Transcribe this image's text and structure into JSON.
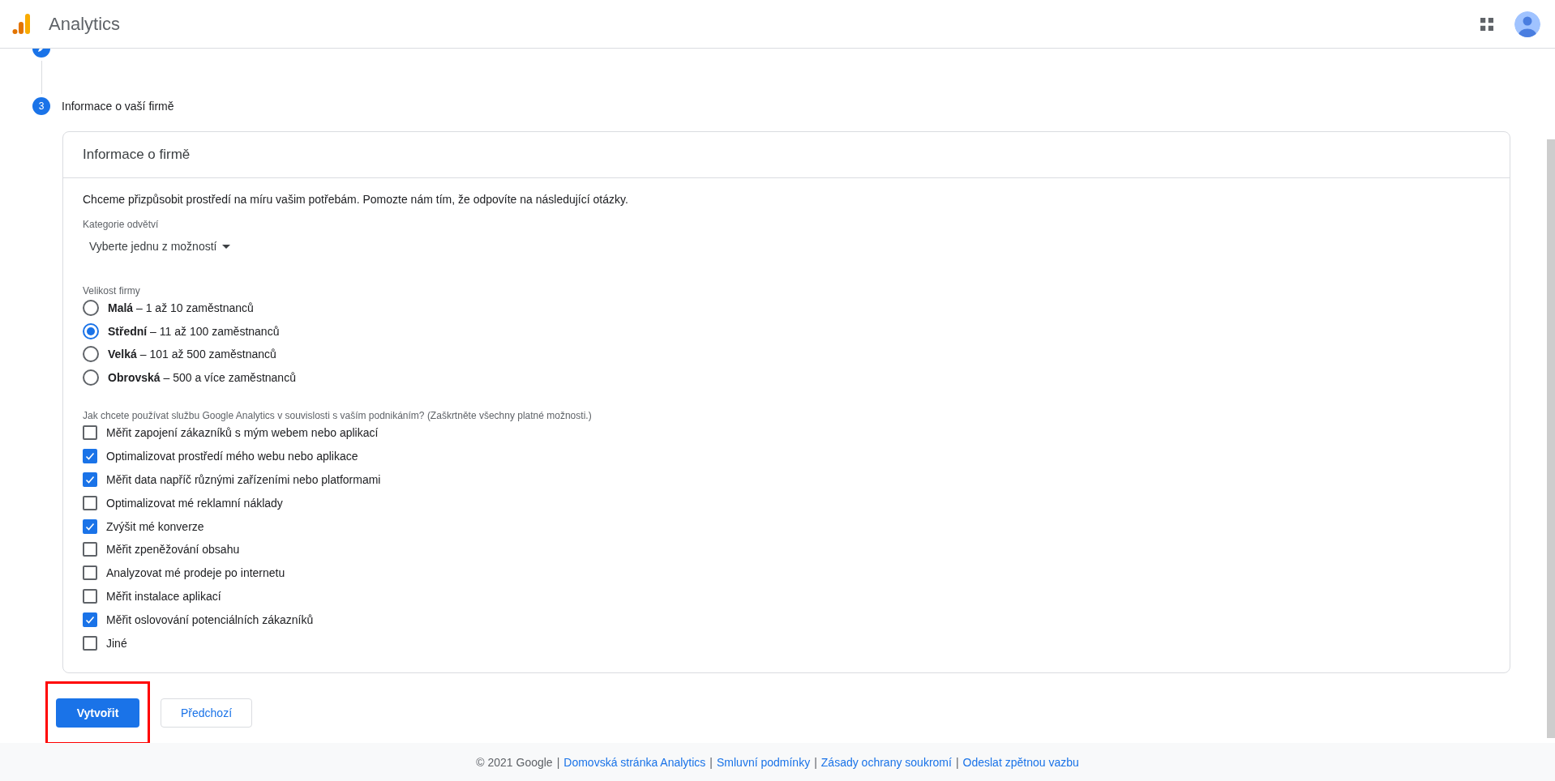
{
  "header": {
    "title": "Analytics"
  },
  "steps": [
    {
      "kind": "done"
    },
    {
      "kind": "current",
      "number": "3",
      "label": "Informace o vaší firmě"
    }
  ],
  "card": {
    "title": "Informace o firmě",
    "intro": "Chceme přizpůsobit prostředí na míru vašim potřebám. Pomozte nám tím, že odpovíte na následující otázky.",
    "industry": {
      "label": "Kategorie odvětví",
      "value": "Vyberte jednu z možností"
    },
    "size": {
      "label": "Velikost firmy",
      "options": [
        {
          "label": "**Malá** – 1 až 10 zaměstnanců",
          "selected": false
        },
        {
          "label": "**Střední** – 11 až 100 zaměstnanců",
          "selected": true
        },
        {
          "label": "**Velká** – 101 až 500 zaměstnanců",
          "selected": false
        },
        {
          "label": "**Obrovská** – 500 a více zaměstnanců",
          "selected": false
        }
      ]
    },
    "usage": {
      "label": "Jak chcete používat službu Google Analytics v souvislosti s vaším podnikáním? (Zaškrtněte všechny platné možnosti.)",
      "options": [
        {
          "label": "Měřit zapojení zákazníků s mým webem nebo aplikací",
          "checked": false
        },
        {
          "label": "Optimalizovat prostředí mého webu nebo aplikace",
          "checked": true
        },
        {
          "label": "Měřit data napříč různými zařízeními nebo platformami",
          "checked": true
        },
        {
          "label": "Optimalizovat mé reklamní náklady",
          "checked": false
        },
        {
          "label": "Zvýšit mé konverze",
          "checked": true
        },
        {
          "label": "Měřit zpeněžování obsahu",
          "checked": false
        },
        {
          "label": "Analyzovat mé prodeje po internetu",
          "checked": false
        },
        {
          "label": "Měřit instalace aplikací",
          "checked": false
        },
        {
          "label": "Měřit oslovování potenciálních zákazníků",
          "checked": true
        },
        {
          "label": "Jiné",
          "checked": false
        }
      ]
    }
  },
  "buttons": [
    {
      "kind": "primary",
      "label": "Vytvořit",
      "highlighted": true
    },
    {
      "kind": "secondary",
      "label": "Předchozí",
      "highlighted": false
    }
  ],
  "footer": {
    "separator": "|",
    "items": [
      {
        "kind": "text",
        "text": "© 2021 Google"
      },
      {
        "kind": "link",
        "text": "Domovská stránka Analytics"
      },
      {
        "kind": "link",
        "text": "Smluvní podmínky"
      },
      {
        "kind": "link",
        "text": "Zásady ochrany soukromí"
      },
      {
        "kind": "link",
        "text": "Odeslat zpětnou vazbu"
      }
    ]
  }
}
